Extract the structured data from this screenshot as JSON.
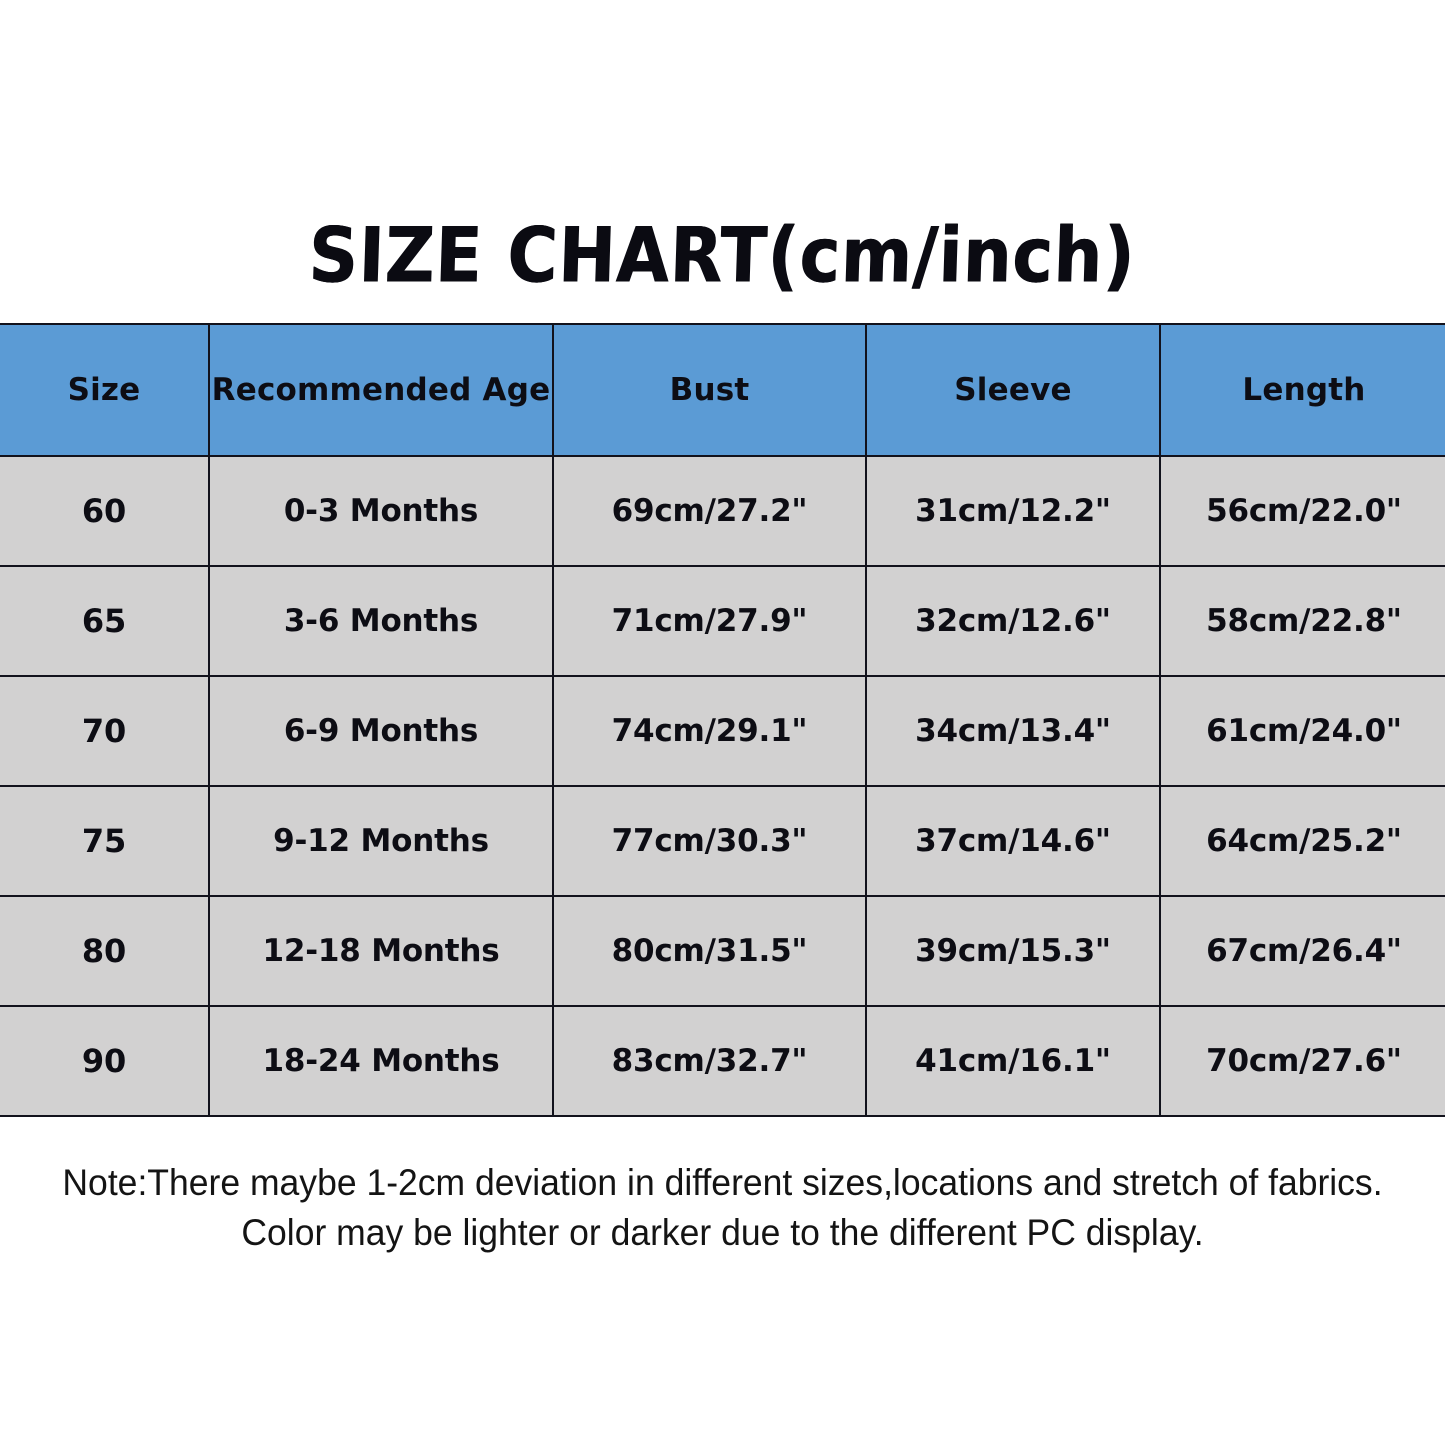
{
  "title": "SIZE CHART(cm/inch)",
  "table": {
    "headers": [
      "Size",
      "Recommended Age",
      "Bust",
      "Sleeve",
      "Length"
    ],
    "rows": [
      {
        "size": "60",
        "age": "0-3 Months",
        "bust": "69cm/27.2\"",
        "sleeve": "31cm/12.2\"",
        "length": "56cm/22.0\""
      },
      {
        "size": "65",
        "age": "3-6 Months",
        "bust": "71cm/27.9\"",
        "sleeve": "32cm/12.6\"",
        "length": "58cm/22.8\""
      },
      {
        "size": "70",
        "age": "6-9 Months",
        "bust": "74cm/29.1\"",
        "sleeve": "34cm/13.4\"",
        "length": "61cm/24.0\""
      },
      {
        "size": "75",
        "age": "9-12 Months",
        "bust": "77cm/30.3\"",
        "sleeve": "37cm/14.6\"",
        "length": "64cm/25.2\""
      },
      {
        "size": "80",
        "age": "12-18 Months",
        "bust": "80cm/31.5\"",
        "sleeve": "39cm/15.3\"",
        "length": "67cm/26.4\""
      },
      {
        "size": "90",
        "age": "18-24 Months",
        "bust": "83cm/32.7\"",
        "sleeve": "41cm/16.1\"",
        "length": "70cm/27.6\""
      }
    ]
  },
  "note": {
    "line1": "Note:There maybe 1-2cm deviation in different sizes,locations and stretch of fabrics.",
    "line2": "Color may be lighter or darker due to the different PC display."
  },
  "colors": {
    "header_blue": "#5b9bd5",
    "cell_gray": "#d2d1d1",
    "border": "#12121c",
    "text": "#0d0d14",
    "background": "#ffffff"
  },
  "chart_data": {
    "type": "table",
    "title": "SIZE CHART(cm/inch)",
    "columns": [
      "Size",
      "Recommended Age",
      "Bust",
      "Sleeve",
      "Length"
    ],
    "rows": [
      [
        "60",
        "0-3 Months",
        "69cm/27.2\"",
        "31cm/12.2\"",
        "56cm/22.0\""
      ],
      [
        "65",
        "3-6 Months",
        "71cm/27.9\"",
        "32cm/12.6\"",
        "58cm/22.8\""
      ],
      [
        "70",
        "6-9 Months",
        "74cm/29.1\"",
        "34cm/13.4\"",
        "61cm/24.0\""
      ],
      [
        "75",
        "9-12 Months",
        "77cm/30.3\"",
        "37cm/14.6\"",
        "64cm/25.2\""
      ],
      [
        "80",
        "12-18 Months",
        "80cm/31.5\"",
        "39cm/15.3\"",
        "67cm/26.4\""
      ],
      [
        "90",
        "18-24 Months",
        "83cm/32.7\"",
        "41cm/16.1\"",
        "70cm/27.6\""
      ]
    ],
    "units": "cm/inch",
    "series": [
      {
        "name": "Bust (cm)",
        "categories": [
          "60",
          "65",
          "70",
          "75",
          "80",
          "90"
        ],
        "values": [
          69,
          71,
          74,
          77,
          80,
          83
        ]
      },
      {
        "name": "Sleeve (cm)",
        "categories": [
          "60",
          "65",
          "70",
          "75",
          "80",
          "90"
        ],
        "values": [
          31,
          32,
          34,
          37,
          39,
          41
        ]
      },
      {
        "name": "Length (cm)",
        "categories": [
          "60",
          "65",
          "70",
          "75",
          "80",
          "90"
        ],
        "values": [
          56,
          58,
          61,
          64,
          67,
          70
        ]
      },
      {
        "name": "Bust (inch)",
        "categories": [
          "60",
          "65",
          "70",
          "75",
          "80",
          "90"
        ],
        "values": [
          27.2,
          27.9,
          29.1,
          30.3,
          31.5,
          32.7
        ]
      },
      {
        "name": "Sleeve (inch)",
        "categories": [
          "60",
          "65",
          "70",
          "75",
          "80",
          "90"
        ],
        "values": [
          12.2,
          12.6,
          13.4,
          14.6,
          15.3,
          16.1
        ]
      },
      {
        "name": "Length (inch)",
        "categories": [
          "60",
          "65",
          "70",
          "75",
          "80",
          "90"
        ],
        "values": [
          22.0,
          22.8,
          24.0,
          25.2,
          26.4,
          27.6
        ]
      }
    ],
    "notes": [
      "Note:There maybe 1-2cm deviation in different sizes,locations and stretch of fabrics.",
      "Color may be lighter or darker due to the different PC display."
    ]
  }
}
